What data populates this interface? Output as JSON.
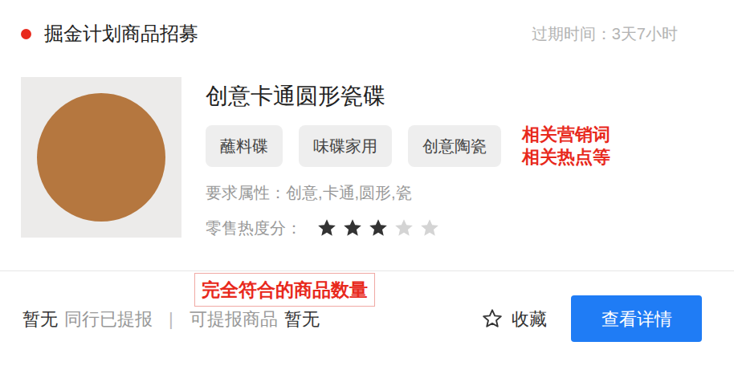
{
  "card": {
    "title": "掘金计划商品招募",
    "title_dot_color": "#e8291c",
    "expiry": "过期时间：3天7小时",
    "product": {
      "name": "创意卡通圆形瓷碟",
      "tags": [
        "蘸料碟",
        "味碟家用",
        "创意陶瓷"
      ],
      "attributes": "要求属性：创意,卡通,圆形,瓷",
      "rating_label": "零售热度分：",
      "stars": 3
    },
    "footer": {
      "peer_count": "暂无",
      "peer_label": "同行已提报",
      "separator": "|",
      "available_label": "可提报商品",
      "available_count": "暂无",
      "favorite": {
        "label": "收藏",
        "selected": false
      },
      "details_button": "查看详情"
    }
  },
  "annotations": {
    "tags_note": [
      "相关营销词",
      "相关热点等"
    ],
    "count_note": "完全符合的商品数量"
  }
}
